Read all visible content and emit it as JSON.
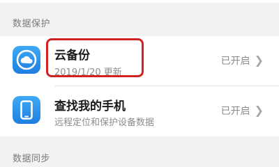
{
  "sections": {
    "data_protection": "数据保护",
    "data_sync": "数据同步"
  },
  "rows": [
    {
      "title": "云备份",
      "subtitle": "2019/1/20 更新",
      "status": "已开启",
      "icon": "cloud-backup-icon"
    },
    {
      "title": "查找我的手机",
      "subtitle": "远程定位和保护设备数据",
      "status": "已开启",
      "icon": "phone-icon"
    }
  ],
  "colors": {
    "accent": "#1e7fe0",
    "highlight": "#d22121"
  }
}
